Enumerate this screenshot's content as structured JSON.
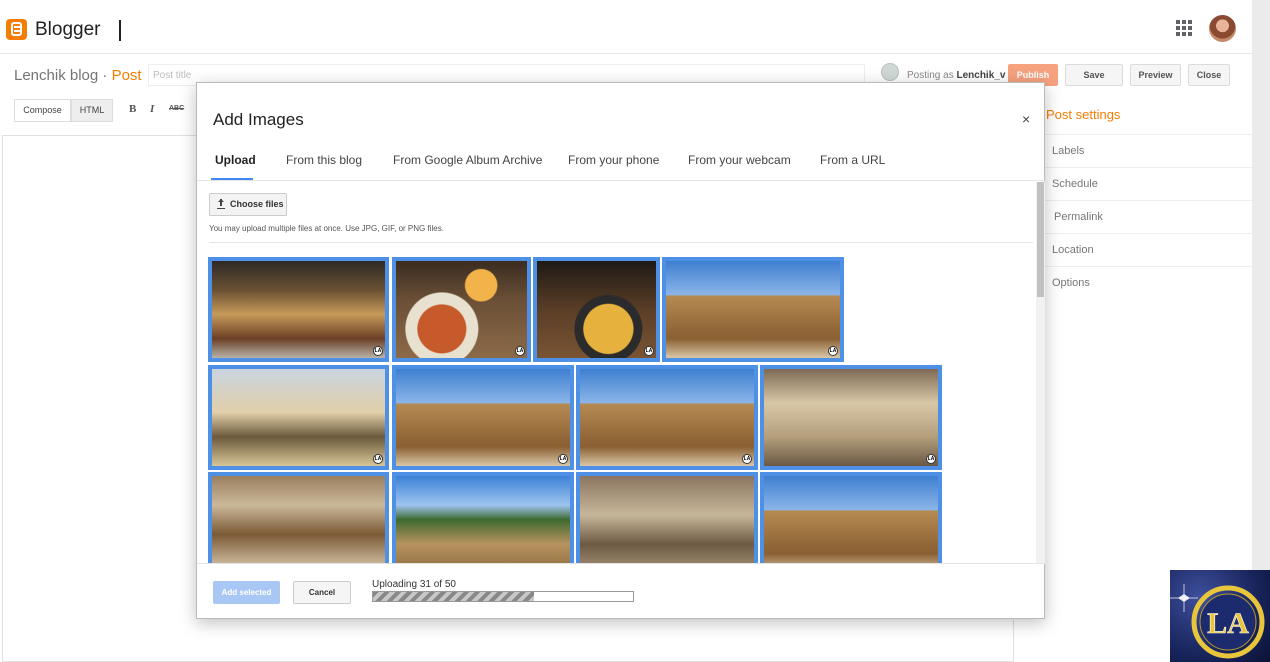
{
  "app": {
    "name": "Blogger"
  },
  "header": {
    "blog_name": "Lenchik blog",
    "separator": " · ",
    "post_label": "Post",
    "post_title_placeholder": "Post title"
  },
  "account": {
    "posting_as_prefix": "Posting as ",
    "username": "Lenchik_v"
  },
  "actions": {
    "publish": "Publish",
    "save": "Save",
    "preview": "Preview",
    "close": "Close"
  },
  "editor_toolbar": {
    "compose": "Compose",
    "html": "HTML",
    "bold": "B",
    "italic": "I",
    "strike": "ABC"
  },
  "post_settings": {
    "title": "Post settings",
    "items": [
      "Labels",
      "Schedule",
      "Permalink",
      "Location",
      "Options"
    ]
  },
  "dialog": {
    "title": "Add Images",
    "close": "×",
    "tabs": [
      "Upload",
      "From this blog",
      "From Google Album Archive",
      "From your phone",
      "From your webcam",
      "From a URL"
    ],
    "active_tab": "Upload",
    "choose_files": "Choose files",
    "hint": "You may upload multiple files at once. Use JPG, GIF, or PNG files.",
    "thumbnails": [
      {
        "icon": "market-photo-icon",
        "selected": true
      },
      {
        "icon": "paella-beer-photo-icon",
        "selected": true
      },
      {
        "icon": "paella-plate-photo-icon",
        "selected": true
      },
      {
        "icon": "cathedral-palms-photo-icon",
        "selected": true
      },
      {
        "icon": "hotel-photo-icon",
        "selected": true
      },
      {
        "icon": "cathedral-tower-photo-icon",
        "selected": true
      },
      {
        "icon": "cathedral-facade-photo-icon",
        "selected": true
      },
      {
        "icon": "gothic-interior-photo-icon",
        "selected": true
      },
      {
        "icon": "altar-photo-icon",
        "selected": true
      },
      {
        "icon": "cloister-palms-photo-icon",
        "selected": true
      },
      {
        "icon": "choir-interior-photo-icon",
        "selected": true
      },
      {
        "icon": "cathedral-wall-photo-icon",
        "selected": true
      }
    ],
    "watermark_badge": "LA",
    "add_selected": "Add selected",
    "cancel": "Cancel",
    "upload_status": "Uploading 31 of 50",
    "upload_progress": 0.62
  },
  "colors": {
    "brand": "#f57d00",
    "selection": "#4d90e6",
    "publish": "#f6a27f",
    "tab_indicator": "#4285f4"
  },
  "watermark": {
    "text": "LA"
  }
}
